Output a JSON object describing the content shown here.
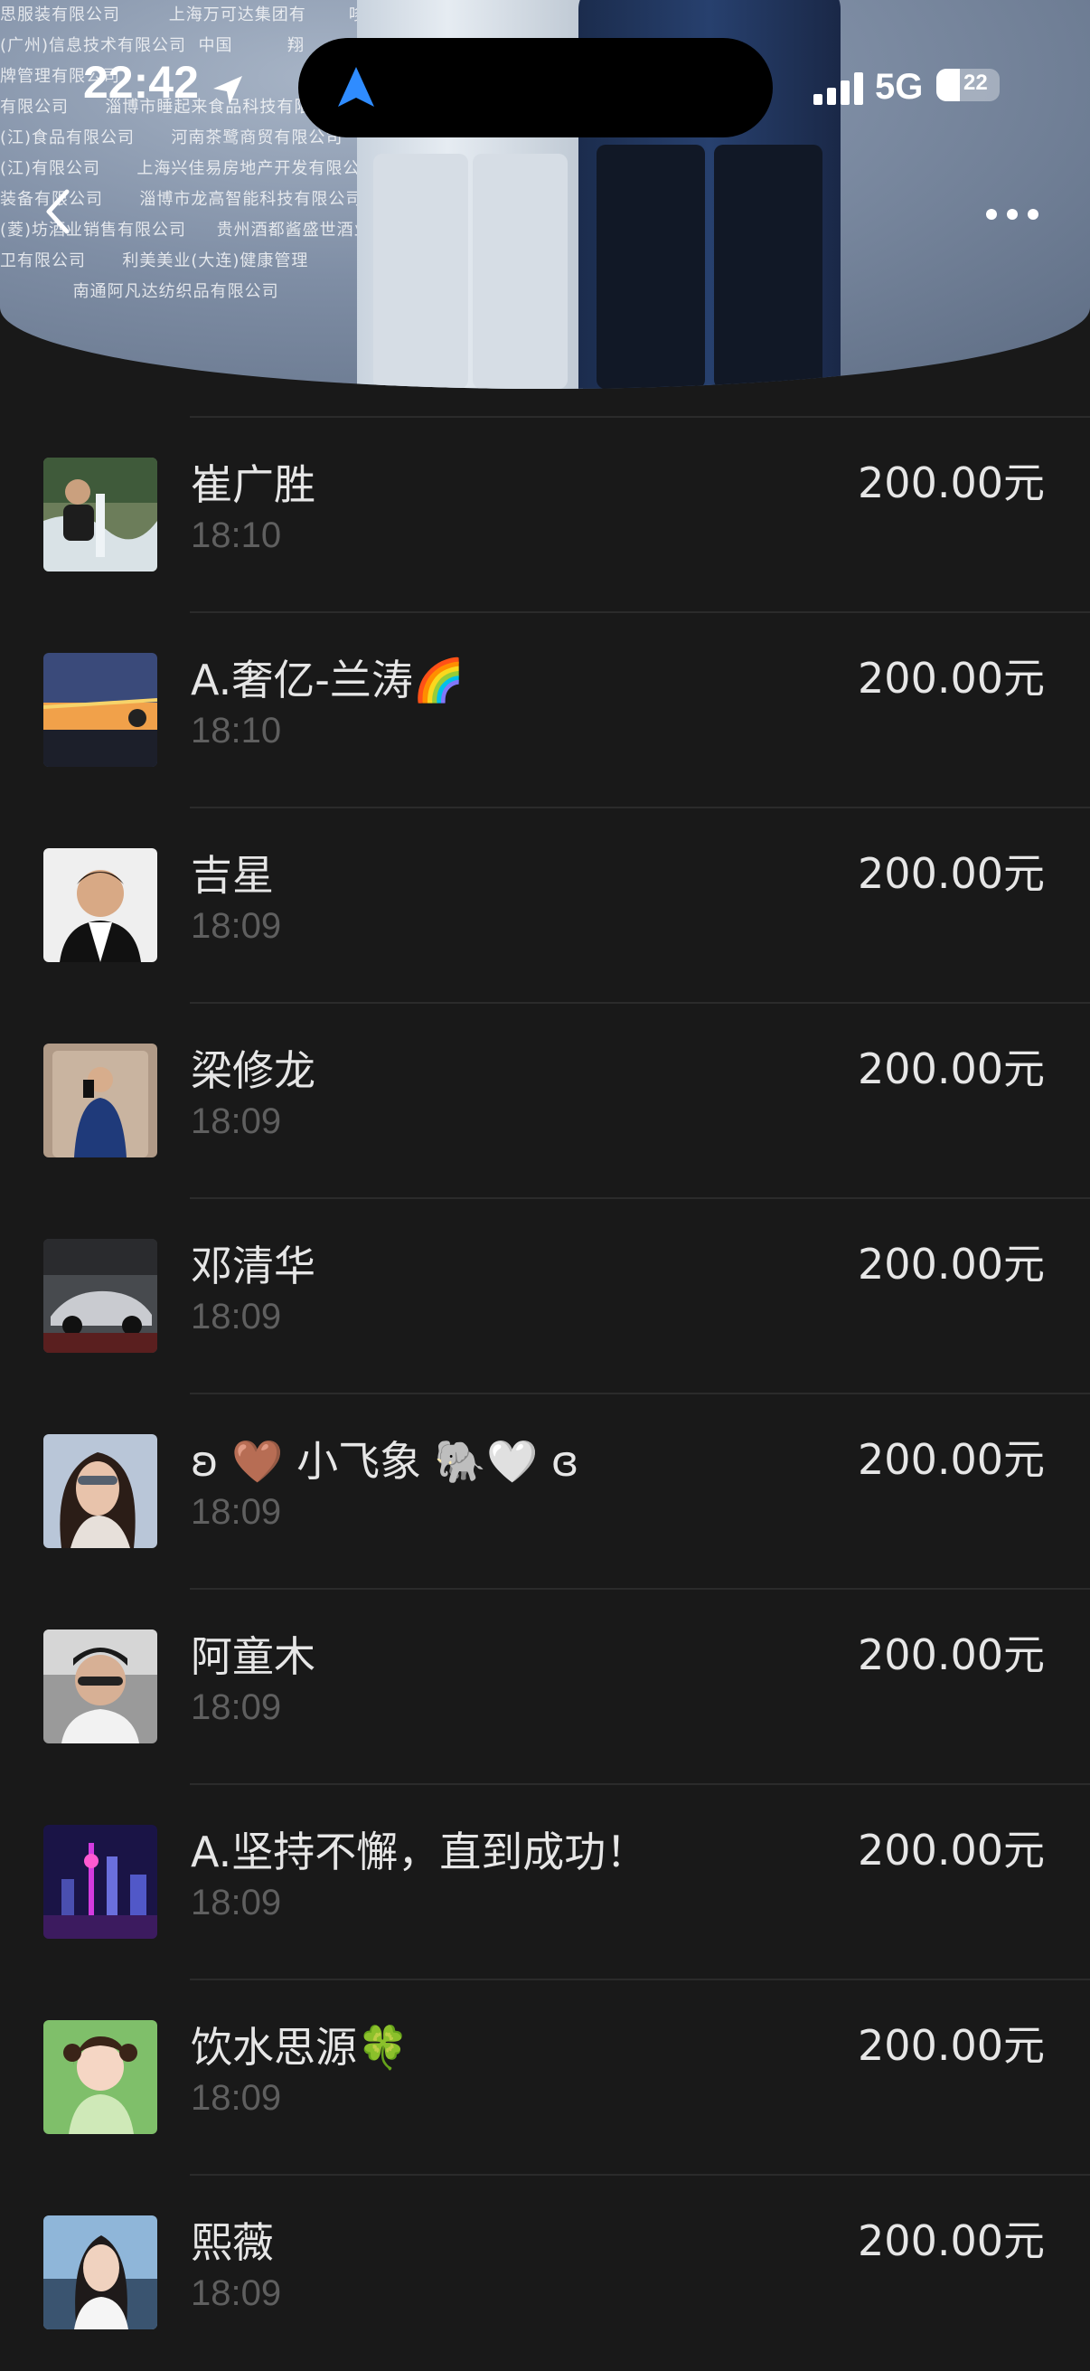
{
  "status_bar": {
    "time": "22:42",
    "network": "5G",
    "battery": "22"
  },
  "header": {
    "backdrop_lines": [
      "思服装有限公司        上海万可达集团有       哆哆          有限公司    壳将军翔澄湖大闸蟹",
      "(广州)信息技术有限公司  中国         翔                    美医疗有限公司   安徽嘉韵",
      "牌管理有限公司                                                          明酒业有限公司",
      "有限公司      淄博市睡起来食品科技有限公司                   四川省赖高港客里酒业有限公司",
      "(江)食品有限公司      河南茶鹭商贸有限公司                     红谷俱乐部    上海细腻治疗",
      "(江)有限公司      上海兴佳易房地产开发有限公司                 管理(集团)有限公司  澳洲",
      "装备有限公司      淄博市龙高智能科技有限公司                 建筑工程有限公司  上海明路",
      "(菱)坊酒业销售有限公司     贵州酒都酱盛世酒业                 航艇俱乐部    上海首尔雁格",
      "卫有限公司      利美美业(大连)健康管理        深圳                海门飞驰租车汽车租赁有限公",
      "            南通阿凡达纺织品有限公司                         中医"
    ]
  },
  "contributions": [
    {
      "name": "崔广胜",
      "time": "18:10",
      "amount": "200.00元",
      "avatar": "avatar-waterfall"
    },
    {
      "name": "  A.奢亿-兰涛🌈",
      "time": "18:10",
      "amount": "200.00元",
      "avatar": "avatar-sunset"
    },
    {
      "name": "吉星",
      "time": "18:09",
      "amount": "200.00元",
      "avatar": "avatar-portrait"
    },
    {
      "name": "梁修龙",
      "time": "18:09",
      "amount": "200.00元",
      "avatar": "avatar-mirror-selfie"
    },
    {
      "name": "邓清华",
      "time": "18:09",
      "amount": "200.00元",
      "avatar": "avatar-classic-car"
    },
    {
      "name": "ʚ 🤎 小飞象 🐘🤍 ɞ",
      "time": "18:09",
      "amount": "200.00元",
      "avatar": "avatar-woman"
    },
    {
      "name": "阿童木",
      "time": "18:09",
      "amount": "200.00元",
      "avatar": "avatar-man-sunglasses"
    },
    {
      "name": "A.坚持不懈，直到成功！",
      "time": "18:09",
      "amount": "200.00元",
      "avatar": "avatar-city-night"
    },
    {
      "name": "饮水思源🍀",
      "time": "18:09",
      "amount": "200.00元",
      "avatar": "avatar-girl-green"
    },
    {
      "name": "熙薇",
      "time": "18:09",
      "amount": "200.00元",
      "avatar": "avatar-woman-outdoor"
    }
  ]
}
